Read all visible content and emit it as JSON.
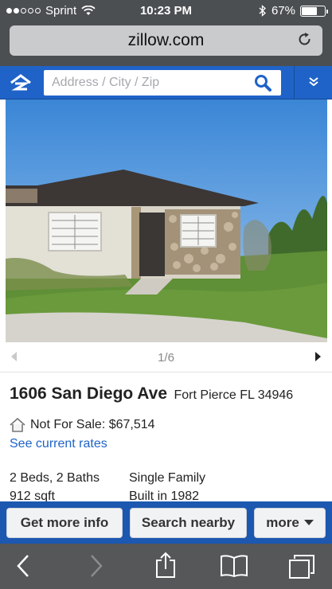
{
  "status_bar": {
    "carrier": "Sprint",
    "time": "10:23 PM",
    "battery": "67%",
    "battery_level": 0.67
  },
  "browser": {
    "url": "zillow.com"
  },
  "search": {
    "placeholder": "Address / City / Zip"
  },
  "photo": {
    "pager": "1/6"
  },
  "listing": {
    "street": "1606 San Diego Ave",
    "city": "Fort Pierce FL 34946",
    "status": "Not For Sale: $67,514",
    "rates_link": "See current rates",
    "beds_baths": "2 Beds, 2 Baths",
    "sqft": "912 sqft",
    "type": "Single Family",
    "built": "Built in 1982"
  },
  "actions": {
    "more_info": "Get more info",
    "search_nearby": "Search nearby",
    "more": "more"
  },
  "icons": [
    "wifi-icon",
    "bluetooth-icon",
    "battery-icon",
    "reload-icon",
    "zillow-logo-icon",
    "search-icon",
    "menu-chevron-icon",
    "prev-arrow-icon",
    "next-arrow-icon",
    "house-icon",
    "back-icon",
    "forward-icon",
    "share-icon",
    "bookmarks-icon",
    "tabs-icon"
  ]
}
